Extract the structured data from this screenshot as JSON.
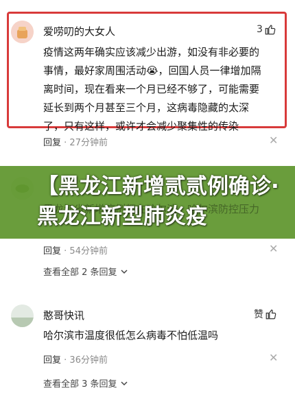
{
  "comments": [
    {
      "username": "爱唠叨的大女人",
      "likes": "3",
      "lines": [
        "疫情这两年确实应该减少出游，如没有非必要的",
        "事情，最好家周围活动😭，回国人员一律增加隔",
        "离时间，现在看来一个月已经不够了，可能需要",
        "延长到两个月甚至三个月，这病毒隐藏的太深",
        "了，只有这样，或许才会减少聚集性的传染"
      ],
      "reply_label": "回复",
      "time": "27分钟前"
    },
    {
      "behind_text": "黑龙江省新增病例都在哈尔滨，哈尔滨防控压力",
      "reply_label": "回复",
      "time": "54分钟前",
      "view_all": "查看全部 2 条回复"
    },
    {
      "username": "憨哥快讯",
      "likes_label": "赞",
      "text": "哈尔滨市温度很低怎么病毒不怕低温吗",
      "reply_label": "回复",
      "time": "36分钟前",
      "view_all": "查看全部 3 条回复"
    }
  ],
  "banner": {
    "title": "【黑龙江新增贰贰例确诊·黑龙江新型肺炎疫"
  },
  "colors": {
    "highlight_border": "#d83a3a",
    "banner_bg": "#5f962d"
  },
  "icons": [
    "thumbs-up-icon",
    "close-icon",
    "chevron-down-icon"
  ]
}
